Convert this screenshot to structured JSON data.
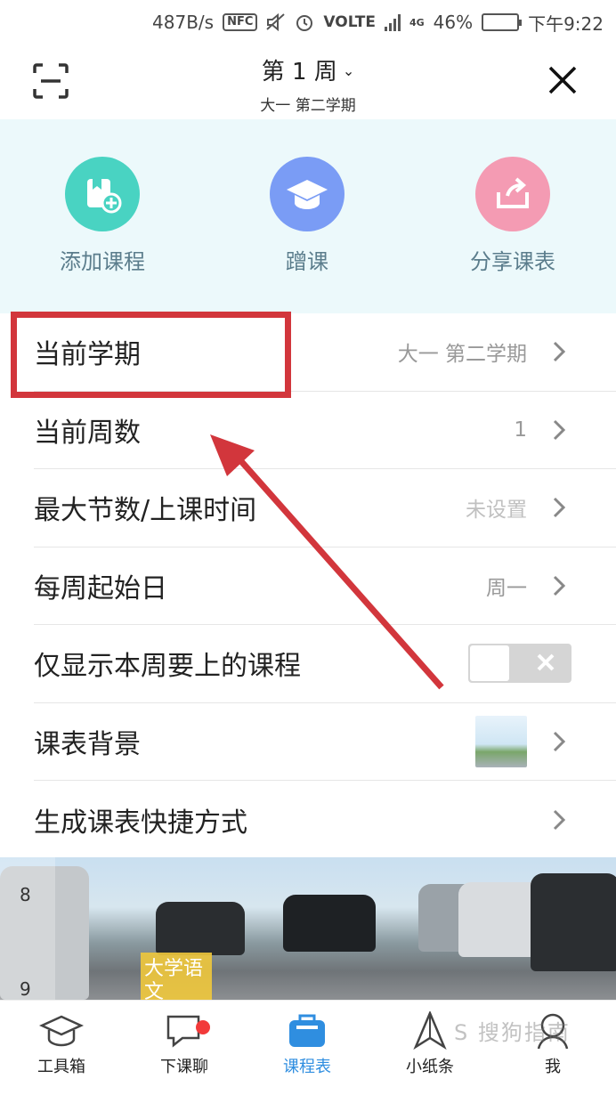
{
  "status_bar": {
    "speed": "487B/s",
    "nfc": "NFC",
    "network": "VOLTE",
    "net_type": "4G",
    "battery": "46%",
    "battery_level": 0.46,
    "time": "下午9:22"
  },
  "header": {
    "week": "第 1 周",
    "term": "大一  第二学期"
  },
  "actions": [
    {
      "label": "添加课程",
      "icon": "add-course-icon",
      "color": "#49d3c2"
    },
    {
      "label": "蹭课",
      "icon": "graduation-cap-icon",
      "color": "#7a9cf5"
    },
    {
      "label": "分享课表",
      "icon": "share-icon",
      "color": "#f49bb3"
    }
  ],
  "settings": {
    "current_term": {
      "label": "当前学期",
      "value": "大一  第二学期"
    },
    "current_week": {
      "label": "当前周数",
      "value": "1"
    },
    "max_sections": {
      "label": "最大节数/上课时间",
      "value": "未设置"
    },
    "week_start": {
      "label": "每周起始日",
      "value": "周一"
    },
    "only_this_week": {
      "label": "仅显示本周要上的课程",
      "enabled": false
    },
    "background": {
      "label": "课表背景"
    },
    "shortcut": {
      "label": "生成课表快捷方式"
    }
  },
  "timetable_preview": {
    "numbers": [
      "8",
      "9"
    ],
    "course": "大学语文"
  },
  "bottom_nav": [
    {
      "label": "工具箱",
      "icon": "toolbox-icon"
    },
    {
      "label": "下课聊",
      "icon": "chat-icon"
    },
    {
      "label": "课程表",
      "icon": "timetable-icon"
    },
    {
      "label": "小纸条",
      "icon": "paper-plane-icon"
    },
    {
      "label": "我",
      "icon": "profile-icon"
    }
  ],
  "watermark": "S 搜狗指南"
}
